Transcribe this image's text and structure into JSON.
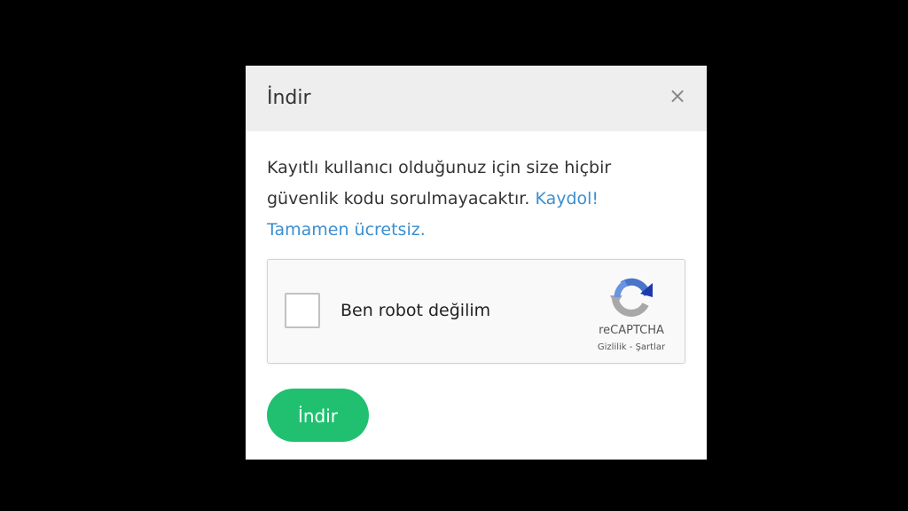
{
  "modal": {
    "title": "İndir",
    "close_glyph": "×",
    "body_text": "Kayıtlı kullanıcı olduğunuz için size hiçbir güvenlik kodu sorulmayacaktır.",
    "register_link": "Kaydol!",
    "free_link": "Tamamen ücretsiz."
  },
  "recaptcha": {
    "label": "Ben robot değilim",
    "brand": "reCAPTCHA",
    "privacy_link": "Gizlilik",
    "separator": " - ",
    "terms_link": "Şartlar",
    "checked": false
  },
  "actions": {
    "download_label": "İndir"
  },
  "colors": {
    "backdrop": "#000000",
    "header_bg": "#eeeeee",
    "link": "#3a8fd0",
    "primary_button": "#20c070"
  },
  "icons": {
    "close": "close-icon",
    "recaptcha": "recaptcha-logo-icon"
  }
}
